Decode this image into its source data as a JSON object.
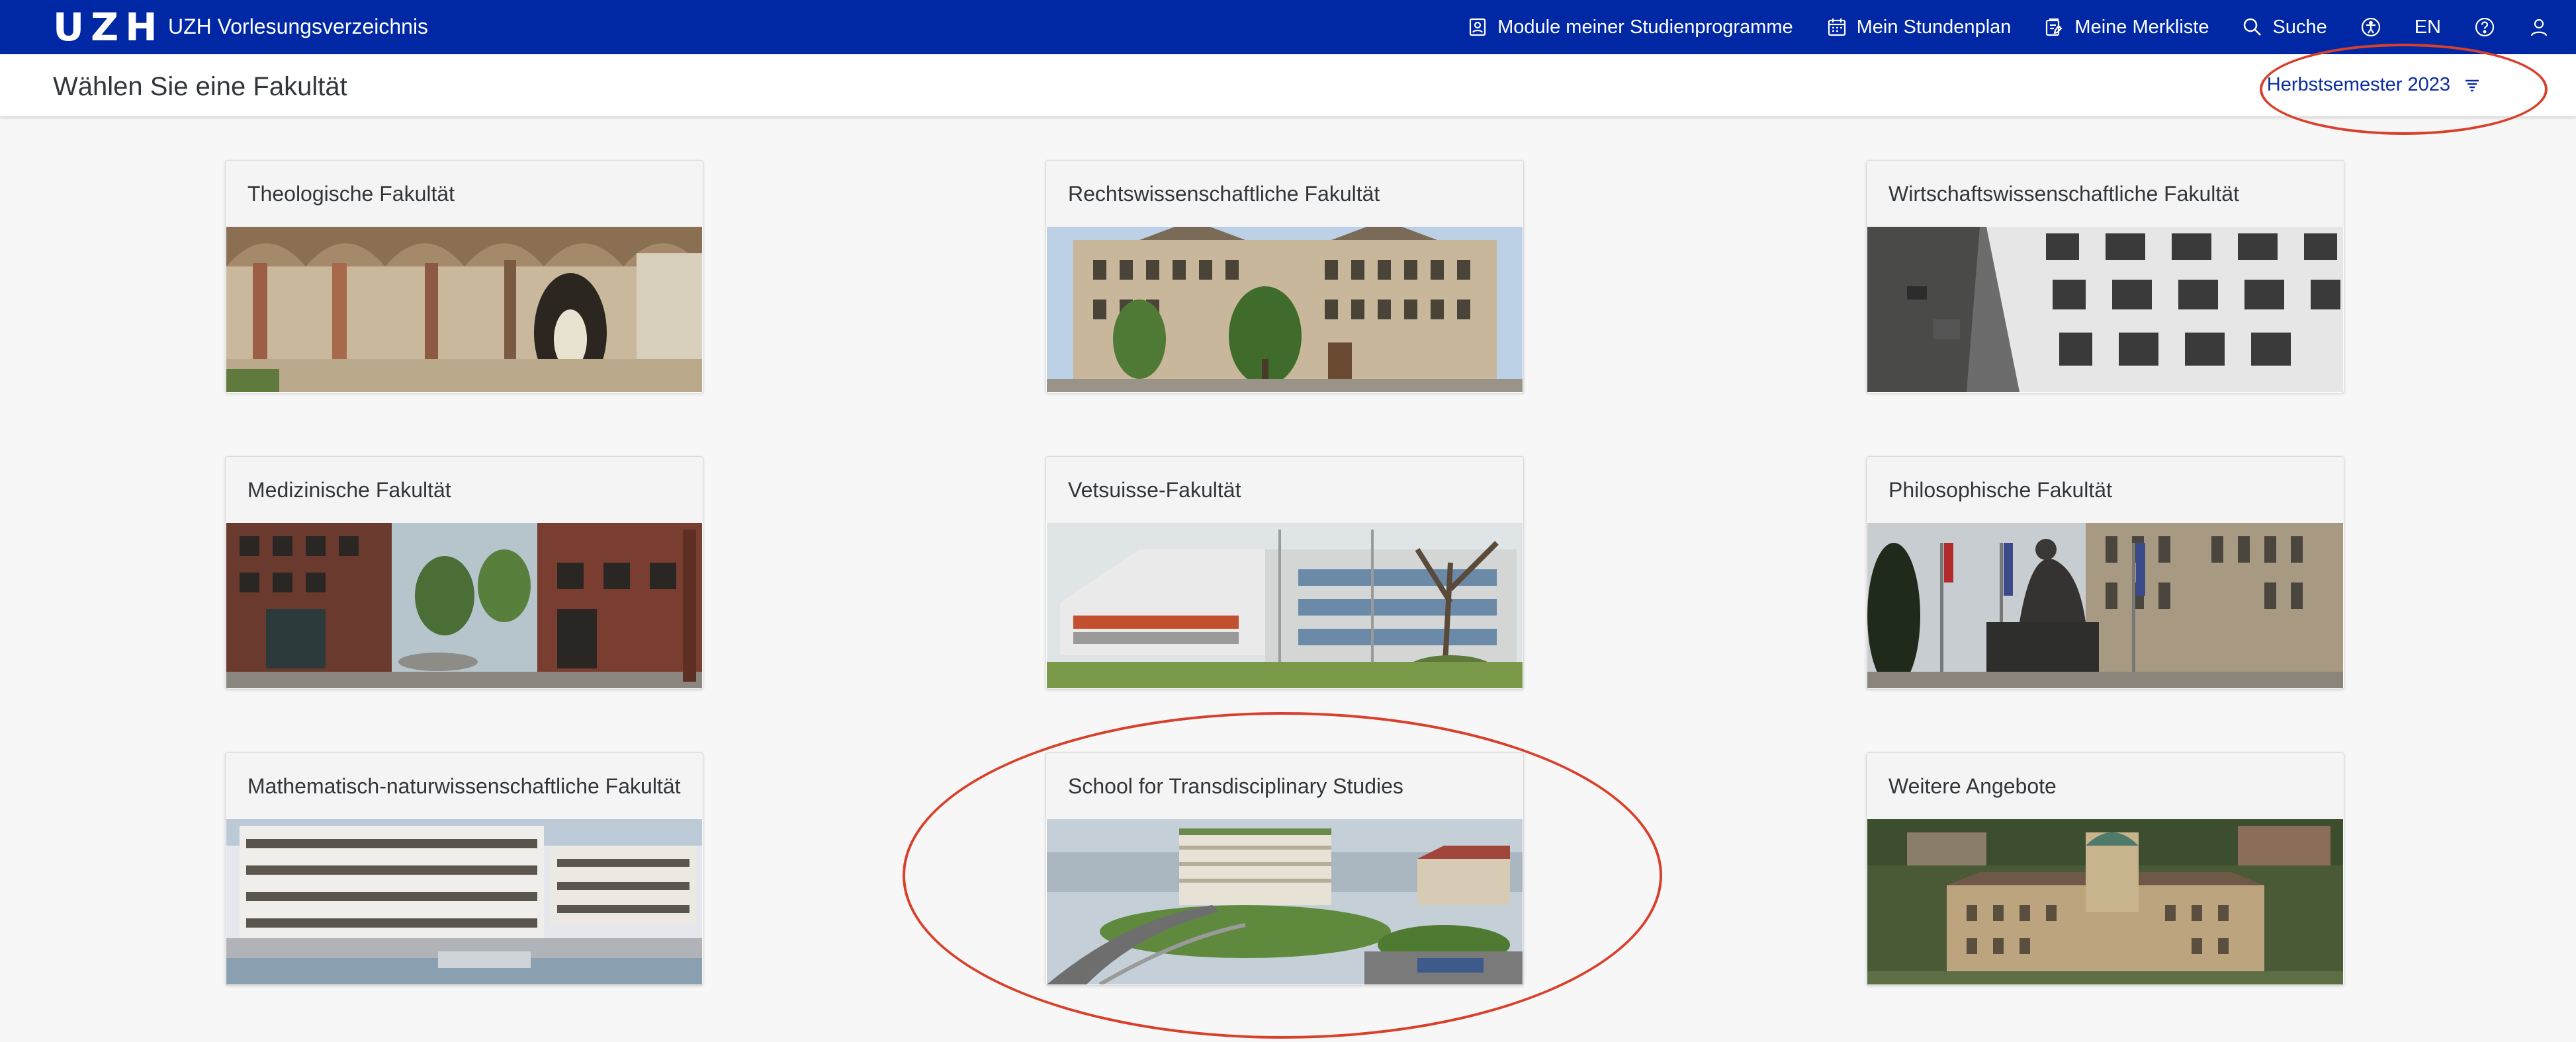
{
  "app": {
    "logo": "UZH",
    "title": "UZH Vorlesungsverzeichnis"
  },
  "nav": {
    "modules": "Module meiner Studienprogramme",
    "schedule": "Mein Stundenplan",
    "watchlist": "Meine Merkliste",
    "search": "Suche",
    "language": "EN"
  },
  "page": {
    "title": "Wählen Sie eine Fakultät",
    "semester": "Herbstsemester 2023"
  },
  "faculties": [
    {
      "name": "Theologische Fakultät"
    },
    {
      "name": "Rechtswissenschaftliche Fakultät"
    },
    {
      "name": "Wirtschaftswissenschaftliche Fakultät"
    },
    {
      "name": "Medizinische Fakultät"
    },
    {
      "name": "Vetsuisse-Fakultät"
    },
    {
      "name": "Philosophische Fakultät"
    },
    {
      "name": "Mathematisch-naturwissenschaftliche Fakultät"
    },
    {
      "name": "School for Transdisciplinary Studies"
    },
    {
      "name": "Weitere Angebote"
    }
  ],
  "colors": {
    "brand": "#0028a5",
    "annotation": "#d9402b",
    "background": "#f7f7f7"
  }
}
